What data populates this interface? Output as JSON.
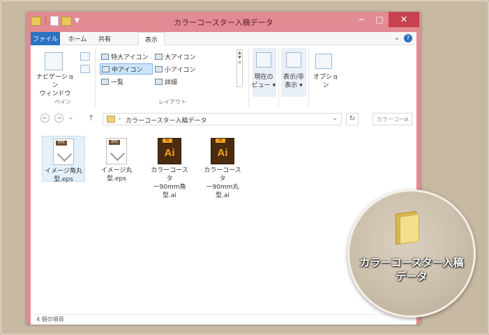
{
  "window": {
    "title": "カラーコースター入稿データ",
    "controls": {
      "minimize": "─",
      "maximize": "□",
      "close": "✕"
    }
  },
  "menu": {
    "file": "ファイル",
    "tabs": [
      "ホーム",
      "共有",
      "表示"
    ],
    "help": "?"
  },
  "ribbon": {
    "pane": {
      "nav_pane_line1": "ナビゲーション",
      "nav_pane_line2": "ウィンドウ",
      "group_label": "ペイン"
    },
    "layout": {
      "items": [
        {
          "label": "特大アイコン"
        },
        {
          "label": "大アイコン"
        },
        {
          "label": "中アイコン",
          "selected": true
        },
        {
          "label": "小アイコン"
        },
        {
          "label": "一覧"
        },
        {
          "label": "詳細"
        }
      ],
      "group_label": "レイアウト"
    },
    "current_view": {
      "line1": "現在の",
      "line2": "ビュー"
    },
    "show_hide": {
      "line1": "表示/非",
      "line2": "表示"
    },
    "options": "オプション"
  },
  "address": {
    "path": "カラーコースター入稿データ",
    "search_placeholder": "カラーコー..."
  },
  "files": [
    {
      "name_line1": "イメージ角丸",
      "name_line2": "型.eps",
      "type": "eps",
      "tag": "EPS",
      "selected": true
    },
    {
      "name_line1": "イメージ丸",
      "name_line2": "型.eps",
      "type": "eps",
      "tag": "EPS",
      "selected": false
    },
    {
      "name_line1": "カラーコースタ",
      "name_line2": "ー90mm角",
      "name_line3": "型.ai",
      "type": "ai",
      "tag": "AI",
      "glyph": "Ai",
      "selected": false
    },
    {
      "name_line1": "カラーコースタ",
      "name_line2": "ー90mm丸",
      "name_line3": "型.ai",
      "type": "ai",
      "tag": "AI",
      "glyph": "Ai",
      "selected": false
    }
  ],
  "status": {
    "item_count": "4 個の項目"
  },
  "magnifier": {
    "folder_label_line1": "カラーコースター入稿",
    "folder_label_line2": "データ"
  },
  "colors": {
    "window_frame": "#e28b93",
    "file_tab": "#2b72c2",
    "close_button": "#c7424e",
    "ai_brown": "#4a2c11",
    "ai_orange": "#f7a21e",
    "background": "#c8b9a3"
  }
}
